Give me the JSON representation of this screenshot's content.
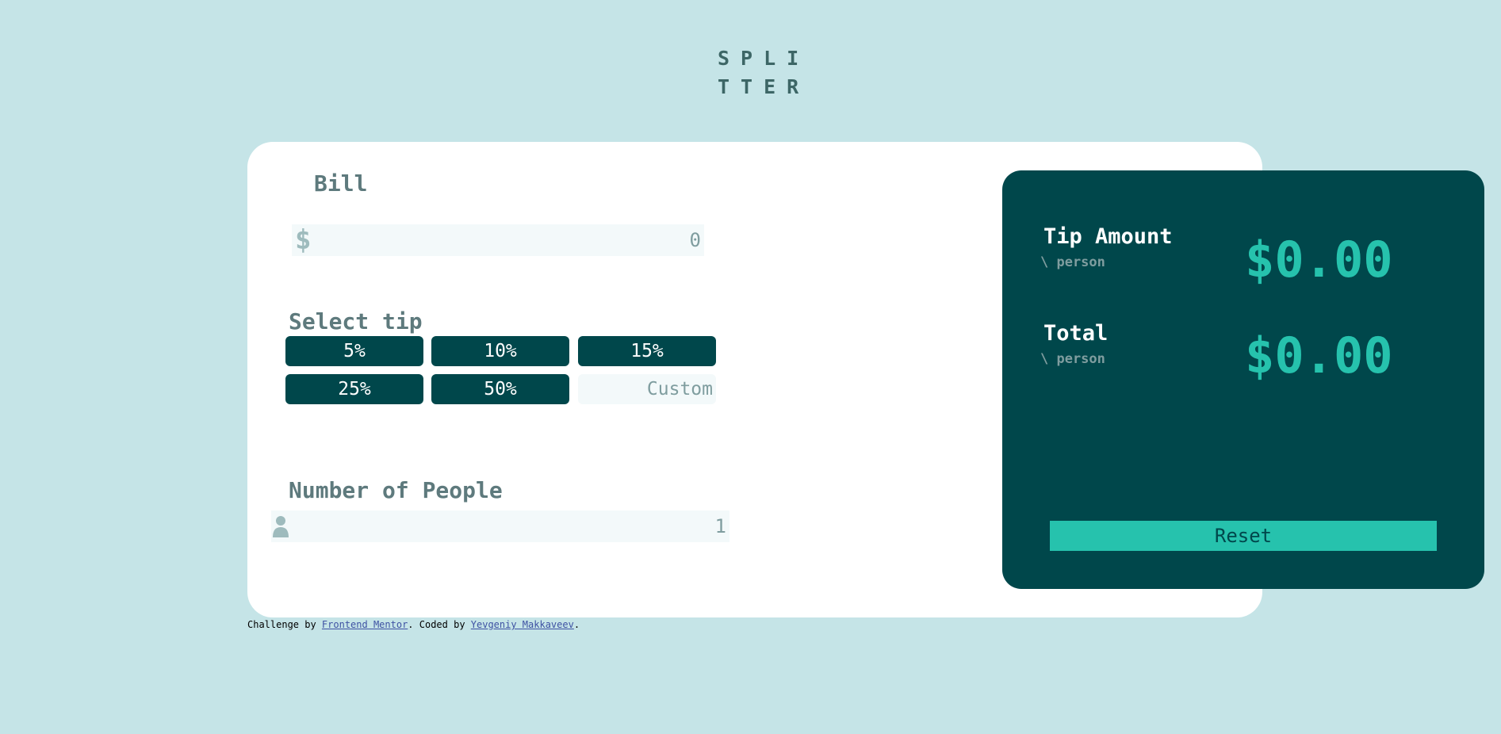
{
  "app": {
    "logo_line1": "SPLI",
    "logo_line2": "TTER"
  },
  "bill": {
    "label": "Bill",
    "currency_symbol": "$",
    "value": "0",
    "currency_icon": "dollar-icon"
  },
  "tip": {
    "label": "Select tip",
    "options": [
      "5%",
      "10%",
      "15%",
      "25%",
      "50%"
    ],
    "custom_placeholder": "Custom"
  },
  "people": {
    "label": "Number of People",
    "value": "1",
    "icon": "person-icon"
  },
  "result": {
    "tip_title": "Tip Amount",
    "tip_sub": "\\ person",
    "tip_value": "$0.00",
    "total_title": "Total",
    "total_sub": "\\ person",
    "total_value": "$0.00",
    "reset_label": "Reset"
  },
  "footer": {
    "prefix": "Challenge by ",
    "link1": "Frontend Mentor",
    "middle": ". Coded by ",
    "link2": "Yevgeniy Makkaveev",
    "suffix": "."
  },
  "colors": {
    "background": "#c5e4e7",
    "dark_teal": "#00474b",
    "accent": "#26c2ad",
    "label_grey": "#5e7a7d",
    "field_bg": "#f3f9fa"
  }
}
